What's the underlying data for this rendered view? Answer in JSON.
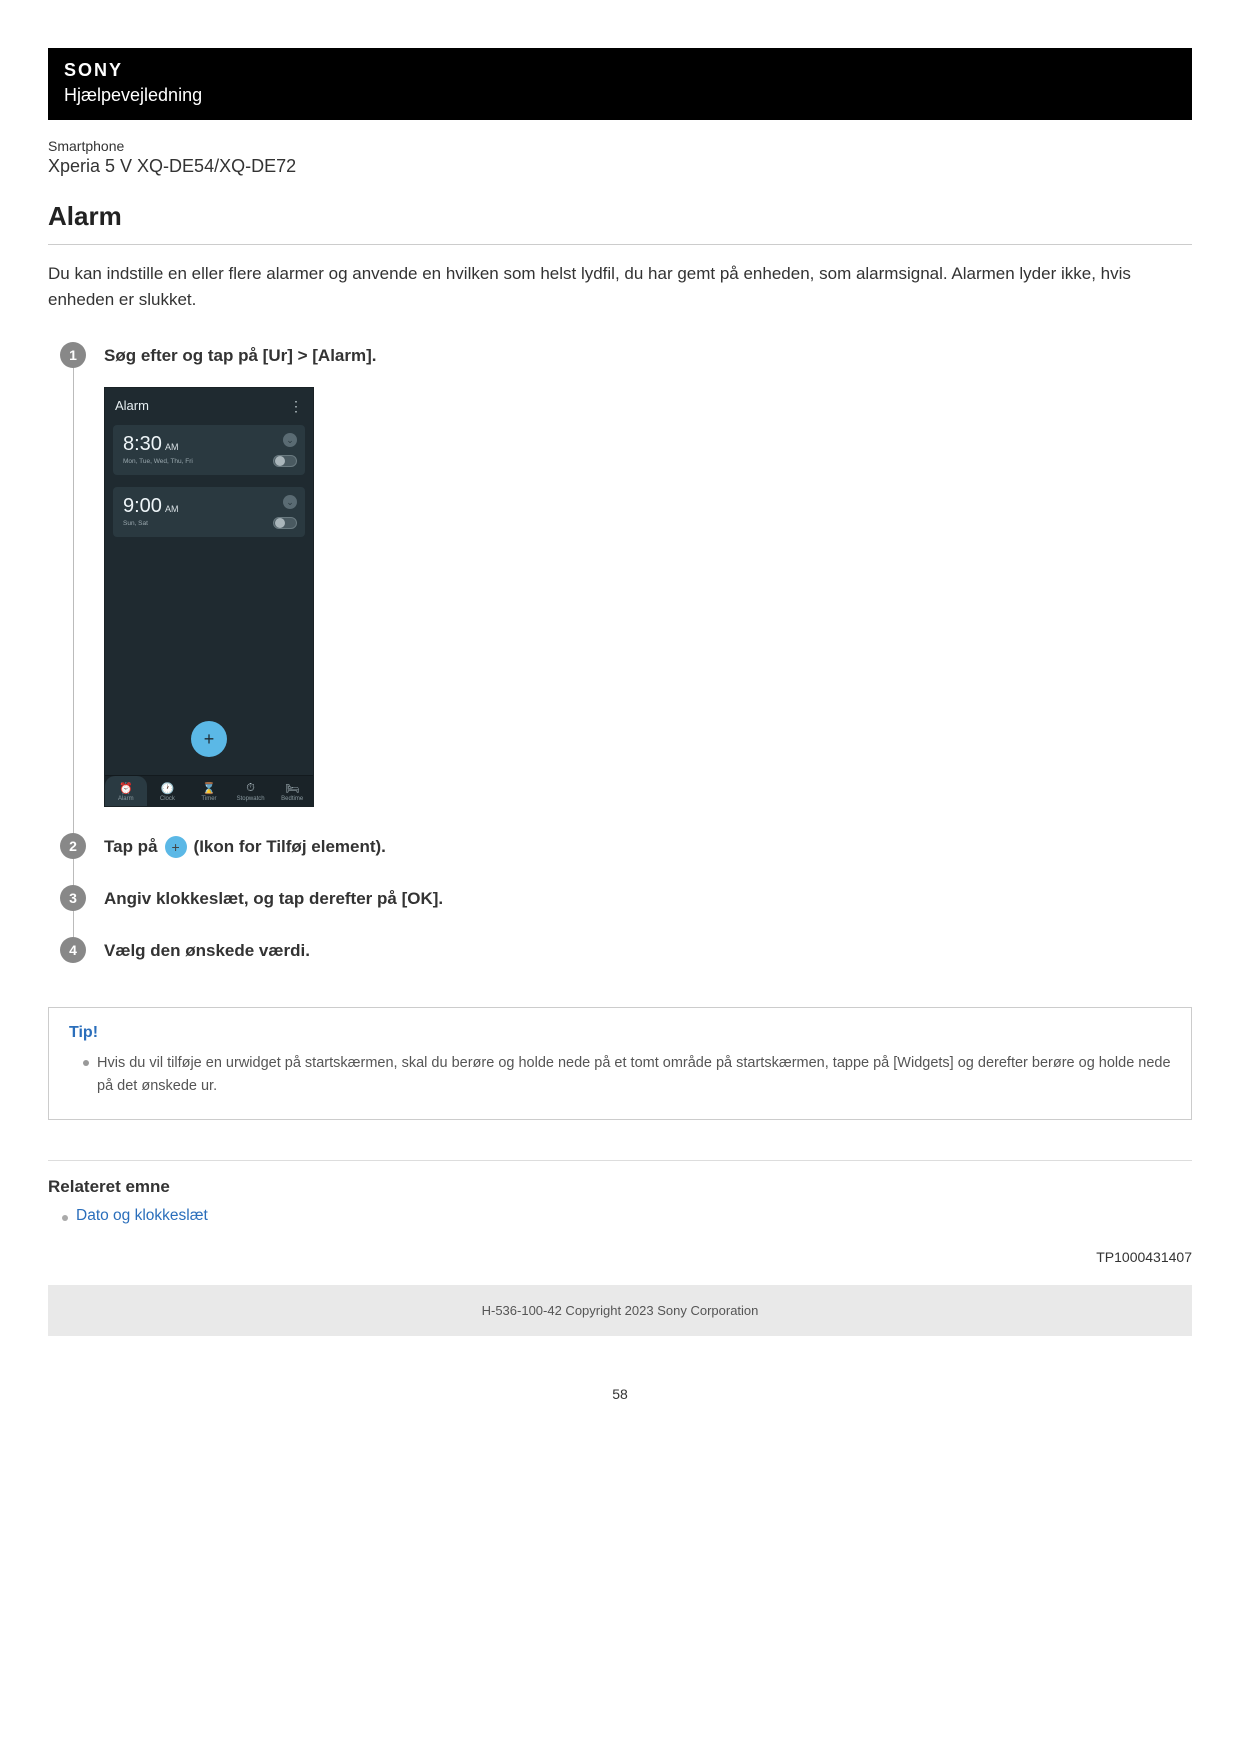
{
  "header": {
    "brand": "SONY",
    "help_guide": "Hjælpevejledning"
  },
  "product": {
    "category": "Smartphone",
    "model": "Xperia 5 V XQ-DE54/XQ-DE72"
  },
  "title": "Alarm",
  "intro": "Du kan indstille en eller flere alarmer og anvende en hvilken som helst lydfil, du har gemt på enheden, som alarmsignal. Alarmen lyder ikke, hvis enheden er slukket.",
  "steps": [
    {
      "num": "1",
      "text": "Søg efter og tap på [Ur] > [Alarm]."
    },
    {
      "num": "2",
      "text_before": "Tap på ",
      "text_after": " (Ikon for Tilføj element)."
    },
    {
      "num": "3",
      "text": "Angiv klokkeslæt, og tap derefter på [OK]."
    },
    {
      "num": "4",
      "text": "Vælg den ønskede værdi."
    }
  ],
  "phone": {
    "header": "Alarm",
    "alarms": [
      {
        "time": "8:30",
        "ampm": "AM",
        "days": "Mon, Tue, Wed, Thu, Fri"
      },
      {
        "time": "9:00",
        "ampm": "AM",
        "days": "Sun, Sat"
      }
    ],
    "fab": "+",
    "nav": [
      {
        "label": "Alarm",
        "icon": "⏰"
      },
      {
        "label": "Clock",
        "icon": "🕐"
      },
      {
        "label": "Timer",
        "icon": "⌛"
      },
      {
        "label": "Stopwatch",
        "icon": "⏱"
      },
      {
        "label": "Bedtime",
        "icon": "🛏"
      }
    ]
  },
  "tip": {
    "title": "Tip!",
    "items": [
      "Hvis du vil tilføje en urwidget på startskærmen, skal du berøre og holde nede på et tomt område på startskærmen, tappe på [Widgets] og derefter berøre og holde nede på det ønskede ur."
    ]
  },
  "related": {
    "title": "Relateret emne",
    "links": [
      "Dato og klokkeslæt"
    ]
  },
  "doc_id": "TP1000431407",
  "footer": "H-536-100-42 Copyright 2023 Sony Corporation",
  "page_number": "58"
}
